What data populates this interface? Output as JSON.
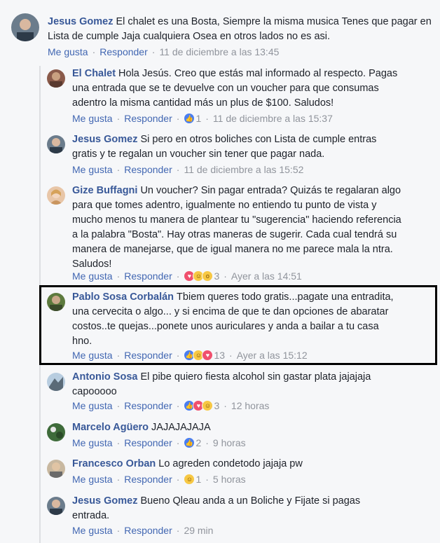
{
  "actions": {
    "like": "Me gusta",
    "reply": "Responder",
    "sep": "·"
  },
  "colors": {
    "link": "#4267b2",
    "name": "#385898",
    "meta": "#90949c",
    "highlight_border": "#000000"
  },
  "comments": [
    {
      "name": "Jesus Gomez",
      "text": "El chalet es una Bosta, Siempre la misma musica Tenes que pagar en Lista de cumple Jaja cualquiera Osea en otros lados no es asi.",
      "reactions": [],
      "count": "",
      "time": "11 de diciembre a las 13:45"
    },
    {
      "name": "El Chalet",
      "text": "Hola Jesús. Creo que estás mal informado al respecto. Pagas una entrada que se te devuelve con un voucher para que consumas adentro la misma cantidad más un plus de $100. Saludos!",
      "reactions": [
        "like"
      ],
      "count": "1",
      "time": "11 de diciembre a las 15:37"
    },
    {
      "name": "Jesus Gomez",
      "text": "Si pero en otros boliches con Lista de cumple entras gratis y te regalan un voucher sin tener que pagar nada.",
      "reactions": [],
      "count": "",
      "time": "11 de diciembre a las 15:52"
    },
    {
      "name": "Gize Buffagni",
      "text": "Un voucher? Sin pagar entrada? Quizás te regalaran algo para que tomes adentro, igualmente no entiendo tu punto de vista y mucho menos tu manera de plantear tu \"sugerencia\" haciendo referencia a la palabra \"Bosta\". Hay otras maneras de sugerir. Cada cual tendrá su manera de manejarse, que de igual manera no me parece mala la ntra. Saludos!",
      "reactions": [
        "love",
        "haha",
        "wow"
      ],
      "count": "3",
      "time": "Ayer a las 14:51"
    },
    {
      "name": "Pablo Sosa Corbalán",
      "text": "Tbiem queres todo gratis...pagate una entradita, una cervecita o algo... y si encima de que te dan opciones de abaratar costos..te quejas...ponete unos auriculares y anda a bailar a tu casa hno.",
      "reactions": [
        "like",
        "haha",
        "love"
      ],
      "count": "13",
      "time": "Ayer a las 15:12"
    },
    {
      "name": "Antonio Sosa",
      "text": "El pibe quiero fiesta alcohol sin gastar plata jajajaja capooooo",
      "reactions": [
        "like",
        "love",
        "haha"
      ],
      "count": "3",
      "time": "12 horas"
    },
    {
      "name": "Marcelo Agüero",
      "text": "JAJAJAJAJA",
      "reactions": [
        "like"
      ],
      "count": "2",
      "time": "9 horas"
    },
    {
      "name": "Francesco Orban",
      "text": "Lo agreden condetodo jajaja pw",
      "reactions": [
        "haha"
      ],
      "count": "1",
      "time": "5 horas"
    },
    {
      "name": "Jesus Gomez",
      "text": "Bueno Qleau anda a un Boliche y Fijate si pagas entrada.",
      "reactions": [],
      "count": "",
      "time": "29 min"
    }
  ]
}
